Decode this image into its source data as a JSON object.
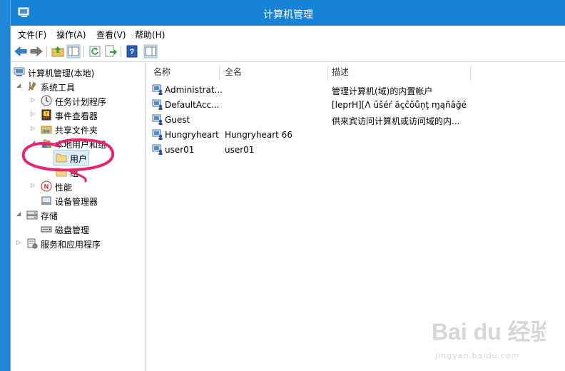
{
  "window": {
    "title": "计算机管理"
  },
  "menu": [
    "文件(F)",
    "操作(A)",
    "查看(V)",
    "帮助(H)"
  ],
  "tree": {
    "root": "计算机管理(本地)",
    "system_tools": "系统工具",
    "task_scheduler": "任务计划程序",
    "event_viewer": "事件查看器",
    "shared_folders": "共享文件夹",
    "local_users_groups": "本地用户和组",
    "users": "用户",
    "groups": "组",
    "performance": "性能",
    "device_manager": "设备管理器",
    "storage": "存储",
    "disk_management": "磁盘管理",
    "services_apps": "服务和应用程序"
  },
  "list": {
    "columns": [
      "名称",
      "全名",
      "描述"
    ],
    "rows": [
      {
        "name": "Administrat...",
        "fullname": "",
        "desc": "管理计算机(域)的内置帐户"
      },
      {
        "name": "DefaultAcc...",
        "fullname": "",
        "desc": "[leprH][Λ ûšéŕ ãçĉôůņţ ɱąñâğé..."
      },
      {
        "name": "Guest",
        "fullname": "",
        "desc": "供来宾访问计算机或访问域的内..."
      },
      {
        "name": "Hungryheart",
        "fullname": "Hungryheart 66",
        "desc": ""
      },
      {
        "name": "user01",
        "fullname": "user01",
        "desc": ""
      }
    ]
  },
  "watermark": {
    "logo": "Bai du 经验",
    "url": "jingyan.baidu.com"
  },
  "colors": {
    "titlebar": "#1683d6",
    "desktop": "#1f86d8",
    "annotation": "#e8246e",
    "selection": "#d9ecfb"
  }
}
